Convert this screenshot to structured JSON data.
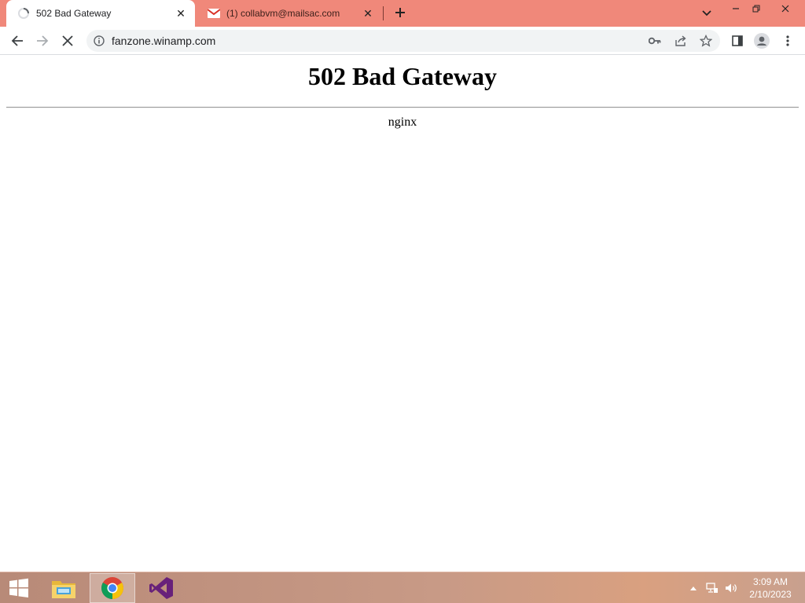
{
  "browser": {
    "tabs": [
      {
        "title": "502 Bad Gateway",
        "active": true
      },
      {
        "title": "(1) collabvm@mailsac.com",
        "active": false
      }
    ],
    "address": {
      "url": "fanzone.winamp.com"
    }
  },
  "page": {
    "heading": "502 Bad Gateway",
    "server": "nginx"
  },
  "taskbar": {
    "apps": [
      "windows-start",
      "file-explorer",
      "google-chrome",
      "visual-studio"
    ],
    "clock": {
      "time": "3:09 AM",
      "date": "2/10/2023"
    }
  },
  "colors": {
    "tabstrip": "#f0887a",
    "taskbar": "#c89a86",
    "vs_purple": "#68217a"
  }
}
